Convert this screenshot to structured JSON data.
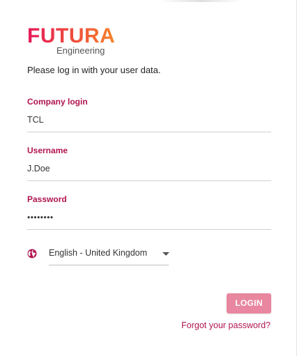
{
  "logo": {
    "brand": "FUTURA",
    "sub": "Engineering"
  },
  "intro_text": "Please log in with your user data.",
  "company_login": {
    "label": "Company login",
    "value": "TCL"
  },
  "username": {
    "label": "Username",
    "value": "J.Doe"
  },
  "password": {
    "label": "Password",
    "value": "••••••••"
  },
  "language": {
    "selected": "English - United Kingdom",
    "icon": "globe-icon"
  },
  "login_button": {
    "label": "LOGIN"
  },
  "forgot_link": {
    "label": "Forgot your password?"
  },
  "colors": {
    "accent": "#b0154f",
    "button": "#e8879f",
    "logo_gradient_start": "#e6195a",
    "logo_gradient_end": "#f6852a"
  }
}
